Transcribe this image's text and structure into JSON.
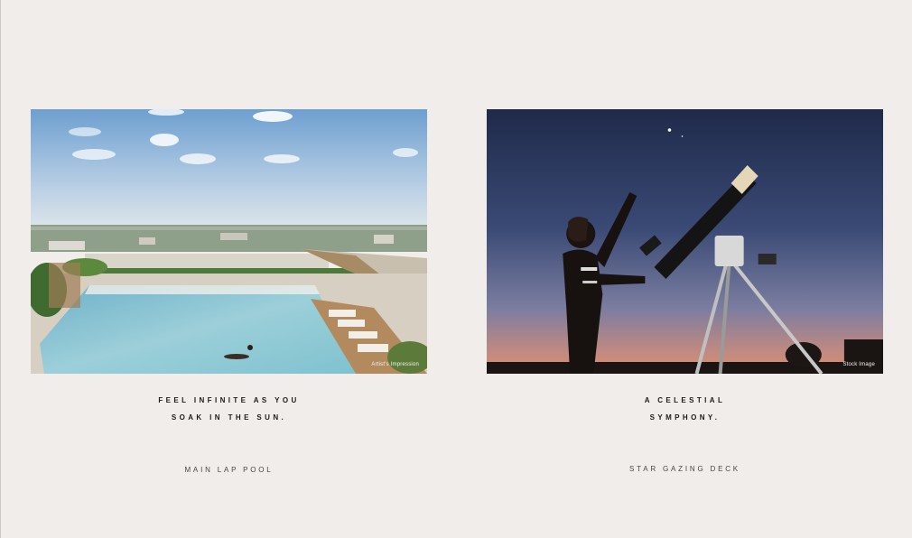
{
  "left_feature": {
    "headline_line1": "FEEL INFINITE AS YOU",
    "headline_line2": "SOAK IN THE SUN.",
    "caption": "MAIN LAP POOL",
    "image_credit": "Artist's Impression"
  },
  "right_feature": {
    "headline_line1": "A CELESTIAL",
    "headline_line2": "SYMPHONY.",
    "caption": "STAR GAZING DECK",
    "image_credit": "Stock Image"
  }
}
